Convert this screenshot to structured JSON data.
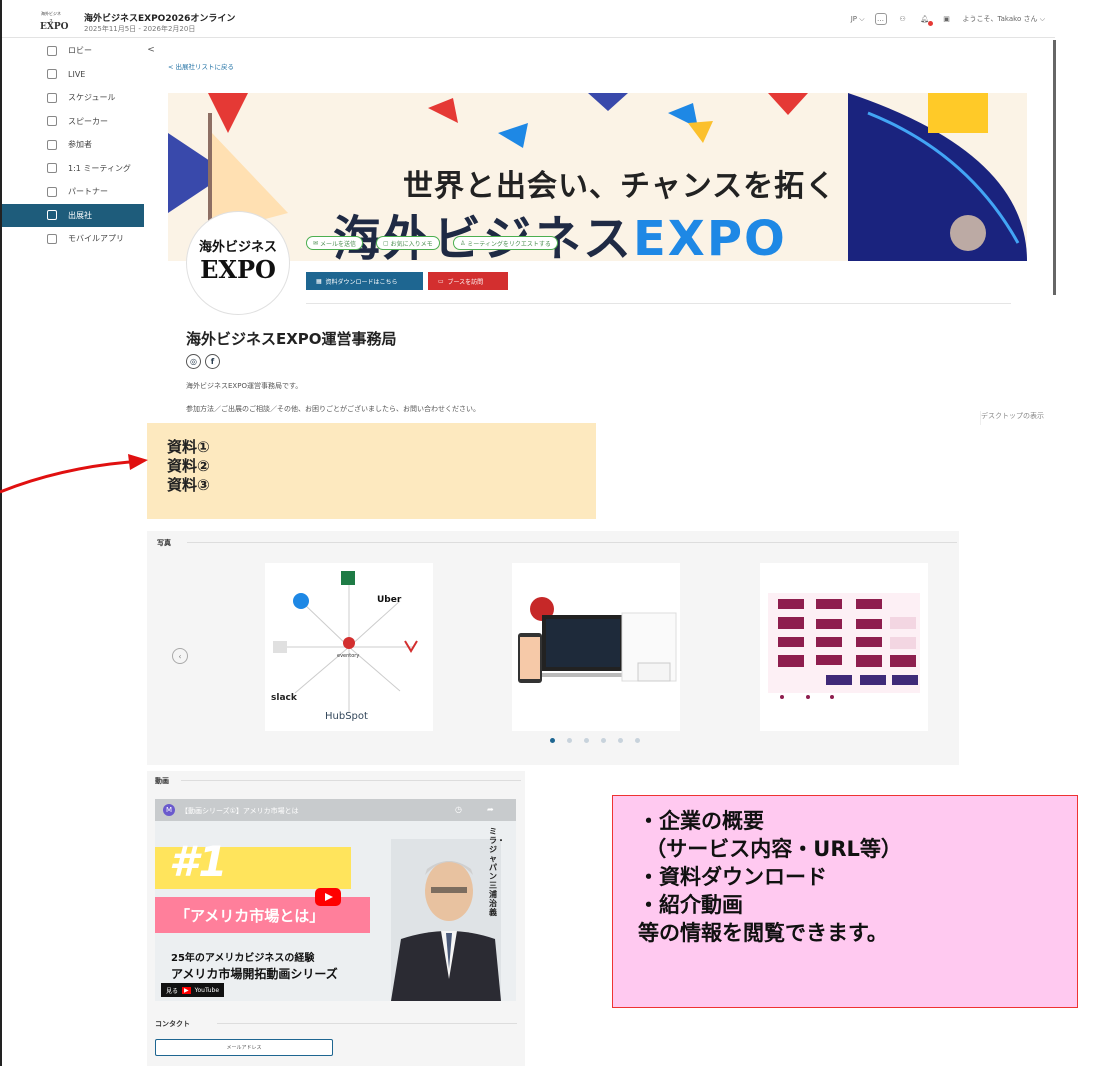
{
  "header": {
    "logo_text_top": "海外ビジネス",
    "logo_text_bottom": "EXPO",
    "title": "海外ビジネスEXPO2026オンライン",
    "dates": "2025年11月5日 - 2026年2月20日",
    "language": "JP",
    "welcome": "ようこそ、Takako さん"
  },
  "sidebar": {
    "items": [
      {
        "label": "ロビー",
        "icon": "home-icon"
      },
      {
        "label": "LIVE",
        "icon": "live-icon"
      },
      {
        "label": "スケジュール",
        "icon": "calendar-icon"
      },
      {
        "label": "スピーカー",
        "icon": "speaker-icon"
      },
      {
        "label": "参加者",
        "icon": "people-icon"
      },
      {
        "label": "1:1 ミーティング",
        "icon": "meeting-icon"
      },
      {
        "label": "パートナー",
        "icon": "partner-icon"
      },
      {
        "label": "出展社",
        "icon": "exhibitor-icon"
      },
      {
        "label": "モバイルアプリ",
        "icon": "mobile-icon"
      }
    ],
    "active_index": 7,
    "collapse_glyph": "<"
  },
  "back_link": "< 出展社リストに戻る",
  "banner": {
    "line1": "世界と出会い、チャンスを拓く",
    "line2_jp": "海外ビジネス",
    "line2_en": "EXPO"
  },
  "avatar": {
    "line1": "海外ビジネス",
    "line2": "EXPO"
  },
  "actions": {
    "send_mail": "メールを送信",
    "favorite": "お気に入りメモ",
    "request_meeting": "ミーティングをリクエストする",
    "download": "資料ダウンロードはこちら",
    "visit_booth": "ブースを訪問"
  },
  "profile": {
    "name": "海外ビジネスEXPO運営事務局",
    "desc1": "海外ビジネスEXPO運営事務局です。",
    "desc2": "参加方法／ご出展のご相談／その他、お困りごとがございましたら、お問い合わせください。",
    "social_web": "◎",
    "social_fb": "f"
  },
  "desktop_view": "デスクトップの表示",
  "materials": [
    "資料①",
    "資料②",
    "資料③"
  ],
  "photos": {
    "label": "写真",
    "card1": {
      "center": "eventory",
      "apps": [
        "Uber",
        "slack",
        "HubSpot"
      ]
    },
    "dots_count": 6,
    "active_dot": 0
  },
  "videos": {
    "label": "動画",
    "channel_initial": "M",
    "title": "【動画シリーズ①】アメリカ市場とは",
    "number": "#1",
    "pink_text": "「アメリカ市場とは」",
    "line1": "25年のアメリカビジネスの経験",
    "line2": "アメリカ市場開拓動画シリーズ",
    "side_text": "ミラ・ジャパン三浦治義",
    "watch": "見る",
    "youtube": "YouTube"
  },
  "contact": {
    "label": "コンタクト",
    "email_button": "メールアドレス"
  },
  "note": {
    "text": "・企業の概要\n （サービス内容・URL等）\n・資料ダウンロード\n・紹介動画\n等の情報を閲覧できます。"
  }
}
